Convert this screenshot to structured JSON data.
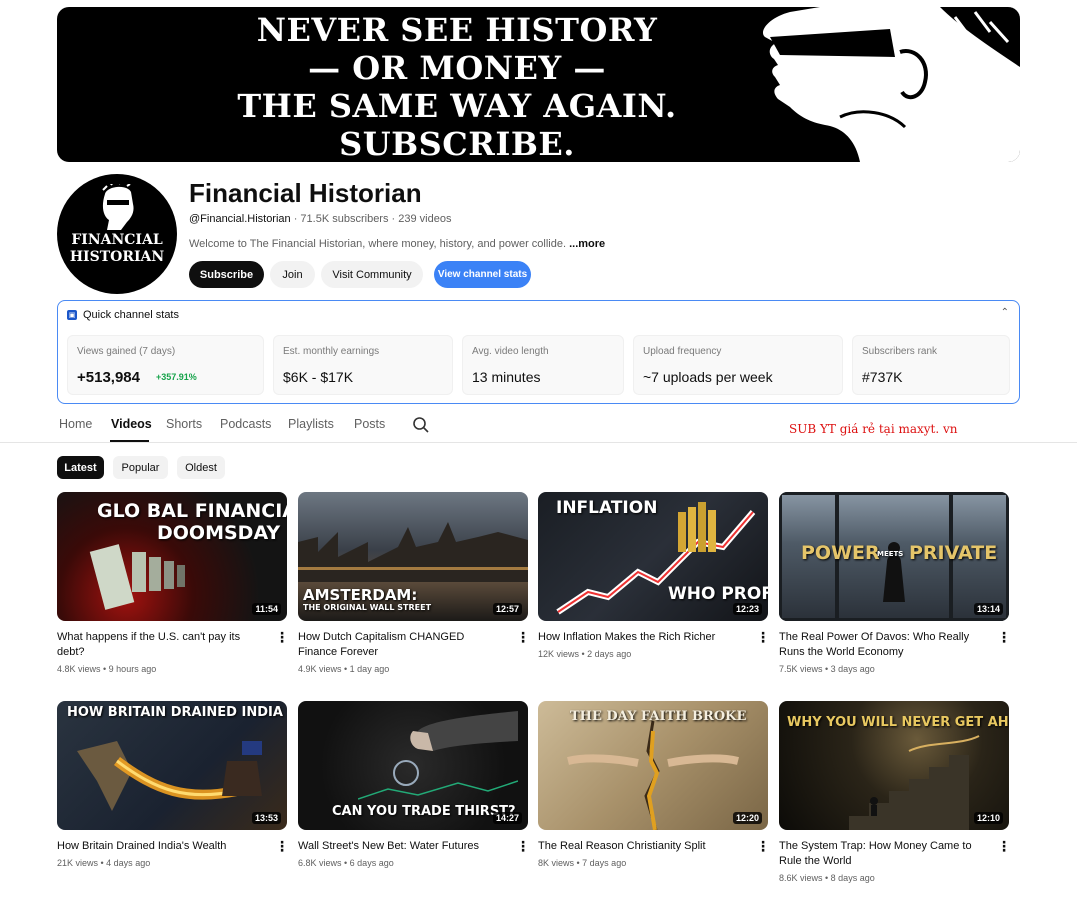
{
  "banner": {
    "lines": [
      "NEVER SEE HISTORY",
      "— OR MONEY —",
      "THE SAME WAY AGAIN.",
      "SUBSCRIBE."
    ]
  },
  "avatar": {
    "lines": [
      "FINANCIAL",
      "HISTORIAN"
    ]
  },
  "channel": {
    "name": "Financial Historian",
    "handle": "@Financial.Historian",
    "stats": " · 71.5K subscribers · 239 videos",
    "description": "Welcome to The Financial Historian, where money, history, and power collide. ",
    "more": "...more"
  },
  "buttons": {
    "subscribe": "Subscribe",
    "join": "Join",
    "community": "Visit Community",
    "stats": "View channel stats"
  },
  "quick_stats": {
    "title": "Quick channel stats",
    "cards": [
      {
        "label": "Views gained (7 days)",
        "value": "+513,984",
        "delta": "+357.91%"
      },
      {
        "label": "Est. monthly earnings",
        "value": "$6K - $17K"
      },
      {
        "label": "Avg. video length",
        "value": "13 minutes"
      },
      {
        "label": "Upload frequency",
        "value": "~7 uploads per week"
      },
      {
        "label": "Subscribers rank",
        "value": "#737K"
      }
    ]
  },
  "tabs": [
    "Home",
    "Videos",
    "Shorts",
    "Podcasts",
    "Playlists",
    "Posts"
  ],
  "promo": "SUB YT giá rẻ tại maxyt. vn",
  "chips": [
    "Latest",
    "Popular",
    "Oldest"
  ],
  "videos": [
    {
      "thumb_text": "GLO BAL FINANCIAL",
      "thumb_text2": "DOOMSDAY",
      "duration": "11:54",
      "title": "What happens if the U.S. can't pay its debt?",
      "meta": "4.8K views • 9 hours ago"
    },
    {
      "thumb_text": "AMSTERDAM:",
      "thumb_text2": "THE ORIGINAL WALL STREET",
      "duration": "12:57",
      "title": "How Dutch Capitalism CHANGED Finance Forever",
      "meta": "4.9K views • 1 day ago"
    },
    {
      "thumb_text": "INFLATION",
      "thumb_text2": "WHO PROFITS",
      "duration": "12:23",
      "title": "How Inflation Makes the Rich Richer",
      "meta": "12K views • 2 days ago"
    },
    {
      "thumb_text": "POWER",
      "thumb_text2": "PRIVATE",
      "thumb_text3": "MEETS",
      "duration": "13:14",
      "title": "The Real Power Of Davos: Who Really Runs the World Economy",
      "meta": "7.5K views • 3 days ago"
    },
    {
      "thumb_text": "HOW BRITAIN DRAINED INDIA",
      "duration": "13:53",
      "title": "How Britain Drained India's Wealth",
      "meta": "21K views • 4 days ago"
    },
    {
      "thumb_text": "CAN YOU TRADE THIRST?",
      "duration": "14:27",
      "title": "Wall Street's New Bet: Water Futures",
      "meta": "6.8K views • 6 days ago"
    },
    {
      "thumb_text": "THE DAY FAITH BROKE",
      "duration": "12:20",
      "title": "The Real Reason Christianity Split",
      "meta": "8K views • 7 days ago"
    },
    {
      "thumb_text": "WHY YOU WILL NEVER GET AHEAD",
      "duration": "12:10",
      "title": "The System Trap: How Money Came to Rule the World",
      "meta": "8.6K views • 8 days ago"
    }
  ]
}
